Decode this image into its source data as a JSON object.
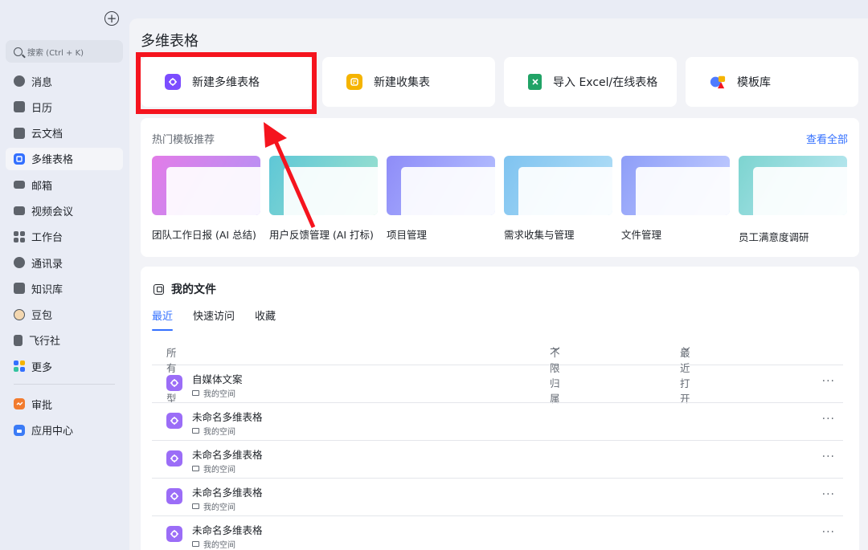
{
  "sidebar": {
    "search_placeholder": "搜索 (Ctrl + K)",
    "items": [
      {
        "label": "消息",
        "icon": "message-icon"
      },
      {
        "label": "日历",
        "icon": "calendar-icon"
      },
      {
        "label": "云文档",
        "icon": "cloud-doc-icon"
      },
      {
        "label": "多维表格",
        "icon": "base-icon",
        "active": true
      },
      {
        "label": "邮箱",
        "icon": "mail-icon"
      },
      {
        "label": "视频会议",
        "icon": "video-icon"
      },
      {
        "label": "工作台",
        "icon": "workplace-icon"
      },
      {
        "label": "通讯录",
        "icon": "contacts-icon"
      },
      {
        "label": "知识库",
        "icon": "wiki-icon"
      },
      {
        "label": "豆包",
        "icon": "doubao-icon"
      },
      {
        "label": "飞行社",
        "icon": "flight-club-icon"
      },
      {
        "label": "更多",
        "icon": "more-apps-icon"
      }
    ],
    "extra_items": [
      {
        "label": "审批",
        "icon": "approval-icon"
      },
      {
        "label": "应用中心",
        "icon": "app-center-icon"
      }
    ]
  },
  "main": {
    "title": "多维表格",
    "quick_actions": [
      {
        "label": "新建多维表格",
        "icon": "new-base-icon",
        "color": "#7c4dff"
      },
      {
        "label": "新建收集表",
        "icon": "new-form-icon",
        "color": "#f5b400"
      },
      {
        "label": "导入 Excel/在线表格",
        "icon": "excel-icon",
        "color": "#21a366"
      },
      {
        "label": "模板库",
        "icon": "template-library-icon",
        "color": "#3370ff"
      }
    ],
    "templates": {
      "title": "热门模板推荐",
      "view_all": "查看全部",
      "items": [
        {
          "label": "团队工作日报 (AI 总结)",
          "icon": "daily-report-thumbnail"
        },
        {
          "label": "用户反馈管理 (AI 打标)",
          "icon": "feedback-thumbnail"
        },
        {
          "label": "项目管理",
          "icon": "project-thumbnail"
        },
        {
          "label": "需求收集与管理",
          "icon": "requirements-thumbnail"
        },
        {
          "label": "文件管理",
          "icon": "file-manage-thumbnail"
        },
        {
          "label": "员工满意度调研",
          "icon": "survey-thumbnail"
        }
      ]
    },
    "files": {
      "title": "我的文件",
      "tabs": [
        "最近",
        "快速访问",
        "收藏"
      ],
      "active_tab": "最近",
      "columns": {
        "type": "所有类型",
        "owner": "不限归属",
        "sort": "最近打开"
      },
      "rows": [
        {
          "name": "自媒体文案",
          "location": "我的空间"
        },
        {
          "name": "未命名多维表格",
          "location": "我的空间"
        },
        {
          "name": "未命名多维表格",
          "location": "我的空间"
        },
        {
          "name": "未命名多维表格",
          "location": "我的空间"
        },
        {
          "name": "未命名多维表格",
          "location": "我的空间"
        }
      ],
      "more_glyph": "···"
    }
  },
  "colors": {
    "accent": "#3370ff",
    "highlight": "#f5141e",
    "base_purple": "#9b6df7"
  }
}
